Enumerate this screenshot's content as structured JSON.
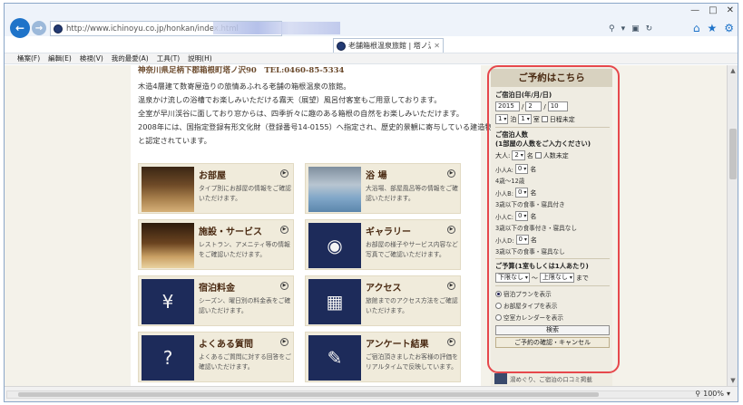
{
  "browser": {
    "url": "http://www.ichinoyu.co.jp/honkan/index.html",
    "tab_title": "老舗箱根温泉旅館 | 塔ノ沢...",
    "menu": [
      "桶案(F)",
      "編輯(E)",
      "検視(V)",
      "我的最愛(A)",
      "工具(T)",
      "説明(H)"
    ],
    "zoom": "100%"
  },
  "page": {
    "address_line": "神奈川県足柄下郡箱根町塔ノ沢90　TEL:0460-85-5334",
    "intro": [
      "木造4層建て数寄屋造りの旅情あふれる老舗の箱根温泉の旅館。",
      "温泉かけ流しの浴槽でお楽しみいただける霧天（展望）風呂付客室もご用意しております。",
      "全室が早川渓谷に面しており窓からは、四季折々に趣のある箱根の自然をお楽しみいただけます。",
      "2008年には、国指定登録有形文化財（登録番号14-0155）へ指定され、歴史的景観に寄与している建造物",
      "と認定されています。"
    ],
    "cards": [
      {
        "title": "お部屋",
        "desc": "タイプ別にお部屋の情報をご確認いただけます。",
        "img": "room"
      },
      {
        "title": "浴 場",
        "desc": "大浴場、部屋風呂等の情報をご確認いただけます。",
        "img": "bath"
      },
      {
        "title": "施設・サービス",
        "desc": "レストラン、アメニティ等の情報をご確認いただけます。",
        "img": "hall"
      },
      {
        "title": "ギャラリー",
        "desc": "お部屋の様子やサービス内容など写真でご確認いただけます。",
        "img": "camera"
      },
      {
        "title": "宿泊料金",
        "desc": "シーズン、曜日別の料金表をご確認いただけます。",
        "img": "yen"
      },
      {
        "title": "アクセス",
        "desc": "旅館までのアクセス方法をご確認いただけます。",
        "img": "car"
      },
      {
        "title": "よくある質問",
        "desc": "よくあるご質問に対する回答をご確認いただけます。",
        "img": "question"
      },
      {
        "title": "アンケート結果",
        "desc": "ご宿泊頂きましたお客様の評価をリアルタイムで反映しています。",
        "img": "survey"
      }
    ]
  },
  "reservation": {
    "header": "ご予約はこちら",
    "date_label": "ご宿泊日(年/月/日)",
    "year": "2015",
    "month": "2",
    "day": "10",
    "nights": "1",
    "nights_unit": "泊",
    "rooms": "1",
    "rooms_unit": "室",
    "date_undecided": "日程未定",
    "people_label": "ご宿泊人数",
    "people_sub": "(1部屋の人数をご入力ください)",
    "adult_label": "大人:",
    "adult_value": "2",
    "adult_unit": "名",
    "people_undecided": "人数未定",
    "childA_label": "小人A:",
    "childA_value": "0",
    "childA_unit": "名",
    "childA_note": "4歳〜12歳",
    "childB_label": "小人B:",
    "childB_value": "0",
    "childB_unit": "名",
    "childB_note": "3歳以下の食事・寝具付き",
    "childC_label": "小人C:",
    "childC_value": "0",
    "childC_unit": "名",
    "childC_note": "3歳以下の食事付き・寝具なし",
    "childD_label": "小人D:",
    "childD_value": "0",
    "childD_unit": "名",
    "childD_note": "3歳以下の食事・寝具なし",
    "budget_label": "ご予算(1室もしくは1人あたり)",
    "budget_min": "下限なし",
    "budget_sep": "〜",
    "budget_max": "上限なし",
    "budget_suffix": "まで",
    "display_options": [
      "宿泊プランを表示",
      "お部屋タイプを表示",
      "空室カレンダーを表示"
    ],
    "search_button": "検索",
    "confirm_button": "ご予約の確認・キャンセル"
  },
  "below_panel_text": "湯めぐり、ご宿泊の口コミ掲載"
}
